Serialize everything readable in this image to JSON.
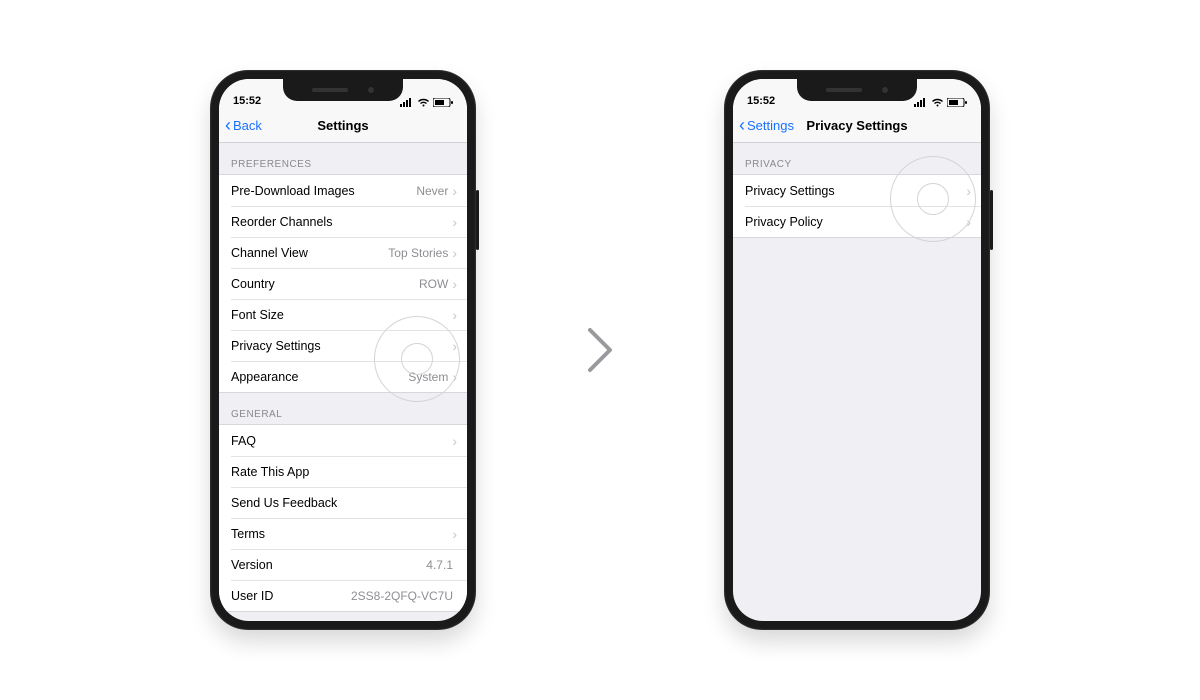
{
  "phone_left": {
    "status_time": "15:52",
    "nav_back": "Back",
    "nav_title": "Settings",
    "section_preferences_header": "PREFERENCES",
    "preferences": [
      {
        "label": "Pre-Download Images",
        "value": "Never",
        "disclosure": true
      },
      {
        "label": "Reorder Channels",
        "value": "",
        "disclosure": true
      },
      {
        "label": "Channel View",
        "value": "Top Stories",
        "disclosure": true
      },
      {
        "label": "Country",
        "value": "ROW",
        "disclosure": true
      },
      {
        "label": "Font Size",
        "value": "",
        "disclosure": true
      },
      {
        "label": "Privacy Settings",
        "value": "",
        "disclosure": true
      },
      {
        "label": "Appearance",
        "value": "System",
        "disclosure": true
      }
    ],
    "section_general_header": "GENERAL",
    "general": [
      {
        "label": "FAQ",
        "value": "",
        "disclosure": true
      },
      {
        "label": "Rate This App",
        "value": "",
        "disclosure": false
      },
      {
        "label": "Send Us Feedback",
        "value": "",
        "disclosure": false
      },
      {
        "label": "Terms",
        "value": "",
        "disclosure": true
      },
      {
        "label": "Version",
        "value": "4.7.1",
        "disclosure": false
      },
      {
        "label": "User ID",
        "value": "2SS8-2QFQ-VC7U",
        "disclosure": false
      }
    ]
  },
  "phone_right": {
    "status_time": "15:52",
    "nav_back": "Settings",
    "nav_title": "Privacy Settings",
    "section_header": "PRIVACY",
    "rows": [
      {
        "label": "Privacy Settings",
        "disclosure": true
      },
      {
        "label": "Privacy Policy",
        "disclosure": true
      }
    ]
  }
}
